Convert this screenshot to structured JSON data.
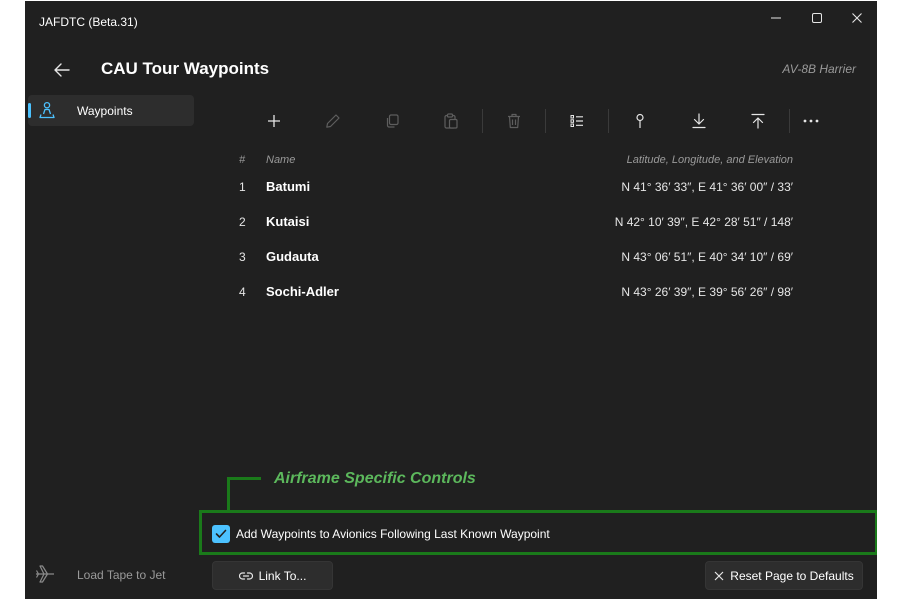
{
  "window": {
    "title": "JAFDTC (Beta.31)"
  },
  "header": {
    "title": "CAU Tour Waypoints",
    "airframe": "AV-8B Harrier"
  },
  "sidebar": {
    "items": [
      {
        "label": "Waypoints",
        "icon": "person-pin-icon",
        "selected": true
      }
    ],
    "load_tape": {
      "label": "Load Tape to Jet",
      "icon": "airplane-icon"
    }
  },
  "toolbar": {
    "buttons": [
      {
        "icon": "add-icon",
        "enabled": true
      },
      {
        "icon": "edit-icon",
        "enabled": false
      },
      {
        "icon": "copy-icon",
        "enabled": false
      },
      {
        "icon": "paste-icon",
        "enabled": false
      },
      {
        "icon": "delete-icon",
        "enabled": false
      },
      {
        "icon": "list-icon",
        "enabled": true
      },
      {
        "icon": "pin-icon",
        "enabled": true
      },
      {
        "icon": "import-icon",
        "enabled": true
      },
      {
        "icon": "export-icon",
        "enabled": true
      },
      {
        "icon": "more-icon",
        "enabled": true
      }
    ]
  },
  "table": {
    "headers": {
      "num": "#",
      "name": "Name",
      "coords": "Latitude, Longitude, and Elevation"
    },
    "rows": [
      {
        "num": "1",
        "name": "Batumi",
        "coords": "N 41° 36′ 33″, E 41° 36′ 00″ / 33′"
      },
      {
        "num": "2",
        "name": "Kutaisi",
        "coords": "N 42° 10′ 39″, E 42° 28′ 51″ / 148′"
      },
      {
        "num": "3",
        "name": "Gudauta",
        "coords": "N 43° 06′ 51″, E 40° 34′ 10″ / 69′"
      },
      {
        "num": "4",
        "name": "Sochi-Adler",
        "coords": "N 43° 26′ 39″, E 39° 56′ 26″ / 98′"
      }
    ]
  },
  "annotation": {
    "label": "Airframe Specific Controls",
    "color": "#1a7a1a"
  },
  "options": {
    "add_waypoints_checkbox": {
      "label": "Add Waypoints to Avionics Following Last Known Waypoint",
      "checked": true
    }
  },
  "footer": {
    "link_button": "Link To...",
    "reset_button": "Reset Page to Defaults"
  },
  "colors": {
    "accent": "#4cc2ff",
    "background": "#202020",
    "annotation_text": "#5cb85c"
  }
}
